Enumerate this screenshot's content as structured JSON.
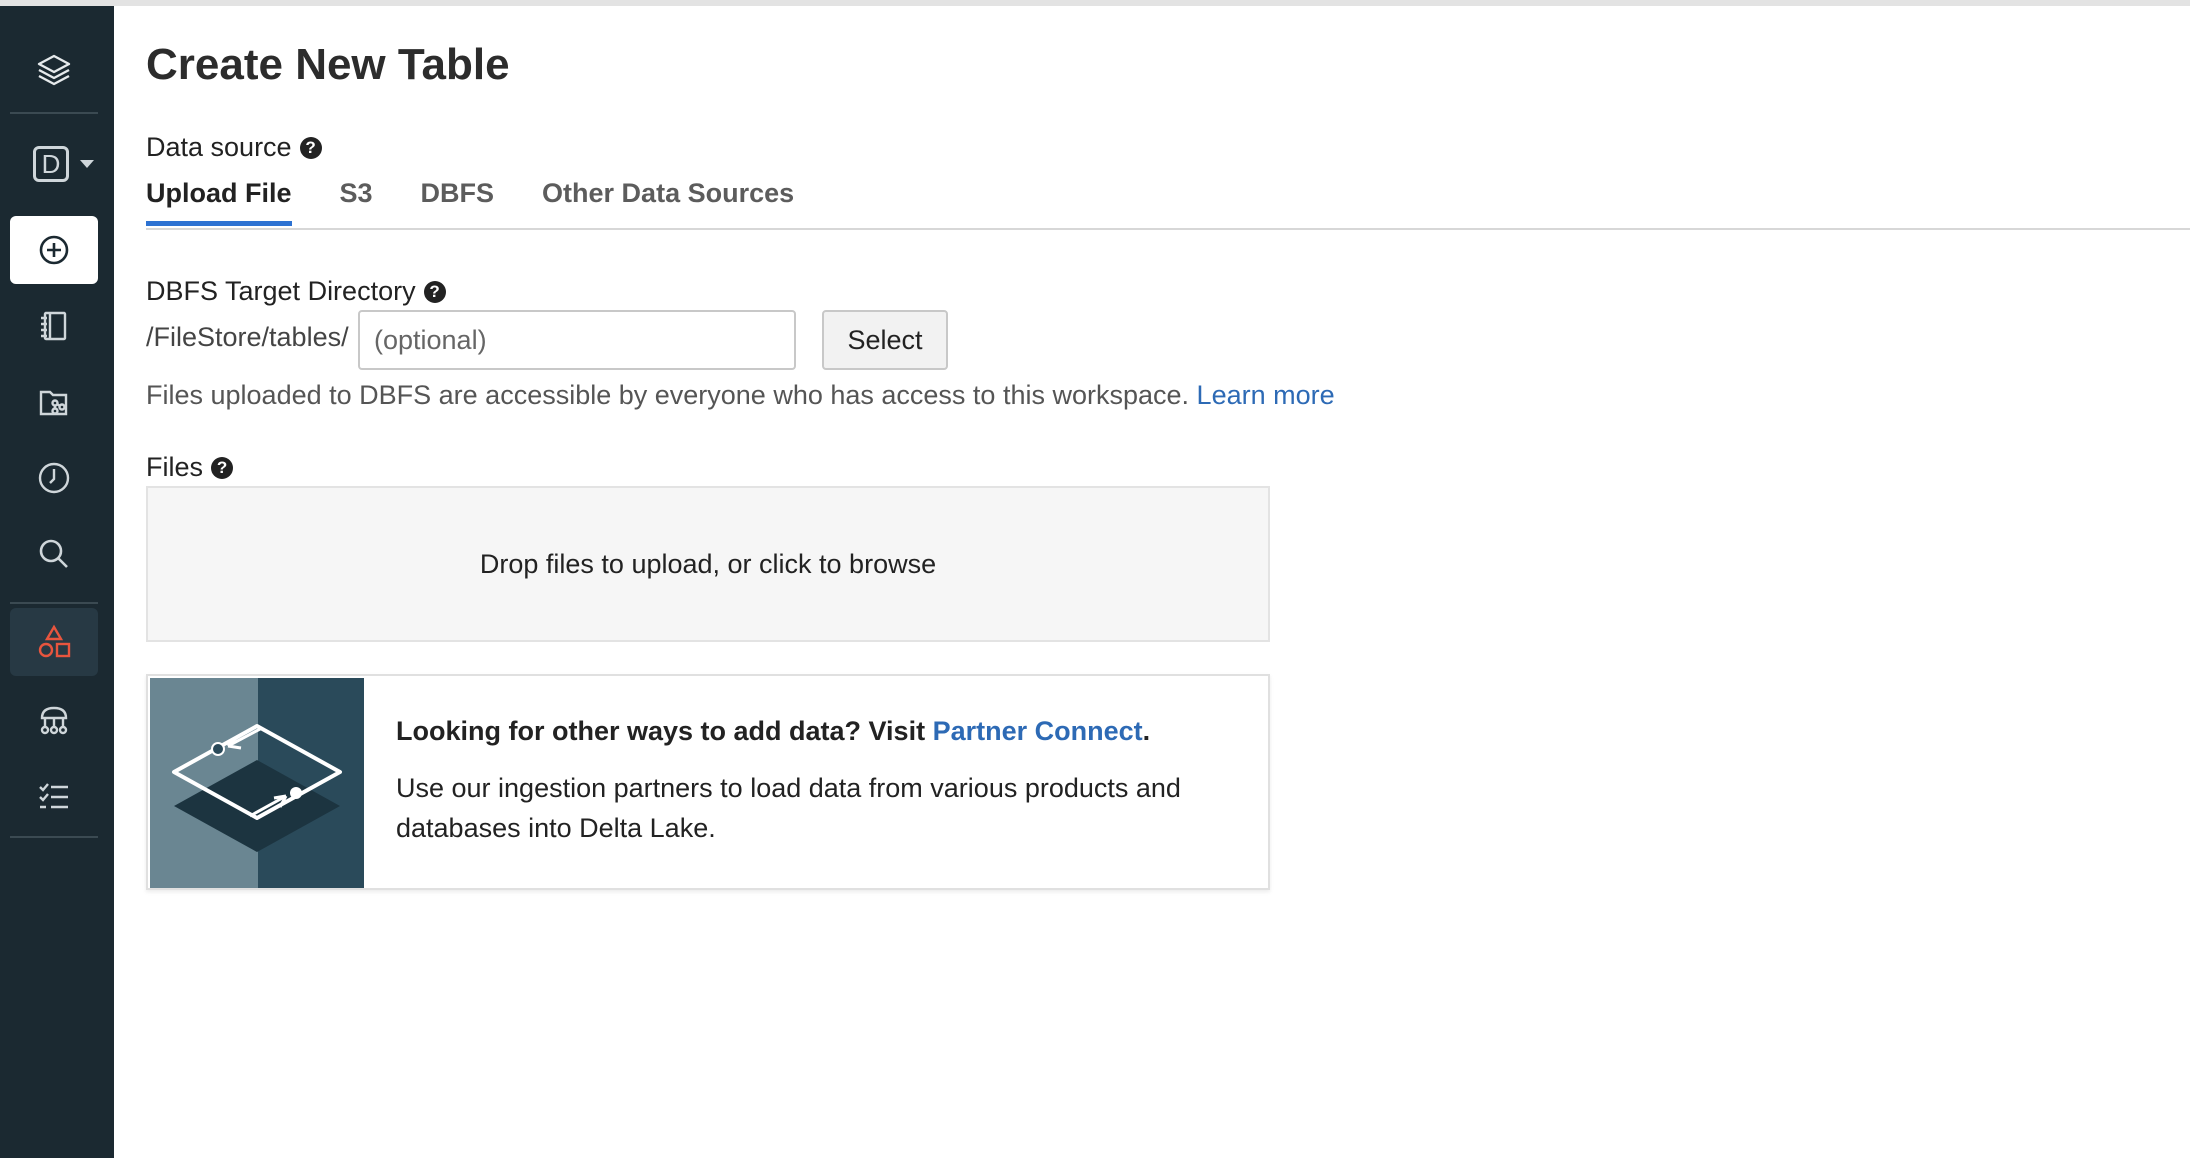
{
  "page": {
    "title": "Create New Table"
  },
  "data_source": {
    "label": "Data source",
    "tabs": [
      {
        "label": "Upload File",
        "active": true
      },
      {
        "label": "S3",
        "active": false
      },
      {
        "label": "DBFS",
        "active": false
      },
      {
        "label": "Other Data Sources",
        "active": false
      }
    ]
  },
  "dbfs_target": {
    "label": "DBFS Target Directory",
    "prefix": "/FileStore/tables/",
    "input_value": "",
    "input_placeholder": "(optional)",
    "select_label": "Select",
    "note": "Files uploaded to DBFS are accessible by everyone who has access to this workspace.",
    "learn_more": "Learn more"
  },
  "files": {
    "label": "Files",
    "dropzone_text": "Drop files to upload, or click to browse"
  },
  "partner": {
    "title_prefix": "Looking for other ways to add data? Visit ",
    "link": "Partner Connect",
    "title_suffix": ".",
    "description": "Use our ingestion partners to load data from various products and databases into Delta Lake."
  },
  "sidebar": {
    "workspace_letter": "D",
    "icons": [
      "layers-icon",
      "workspace-switcher",
      "create-icon",
      "notebook-icon",
      "repos-icon",
      "recents-icon",
      "search-icon",
      "data-icon",
      "compute-icon",
      "jobs-icon"
    ]
  },
  "colors": {
    "sidebar_bg": "#1b2931",
    "accent": "#2d72d2",
    "link": "#2d6ab5",
    "data_icon_active": "#e8553e"
  }
}
